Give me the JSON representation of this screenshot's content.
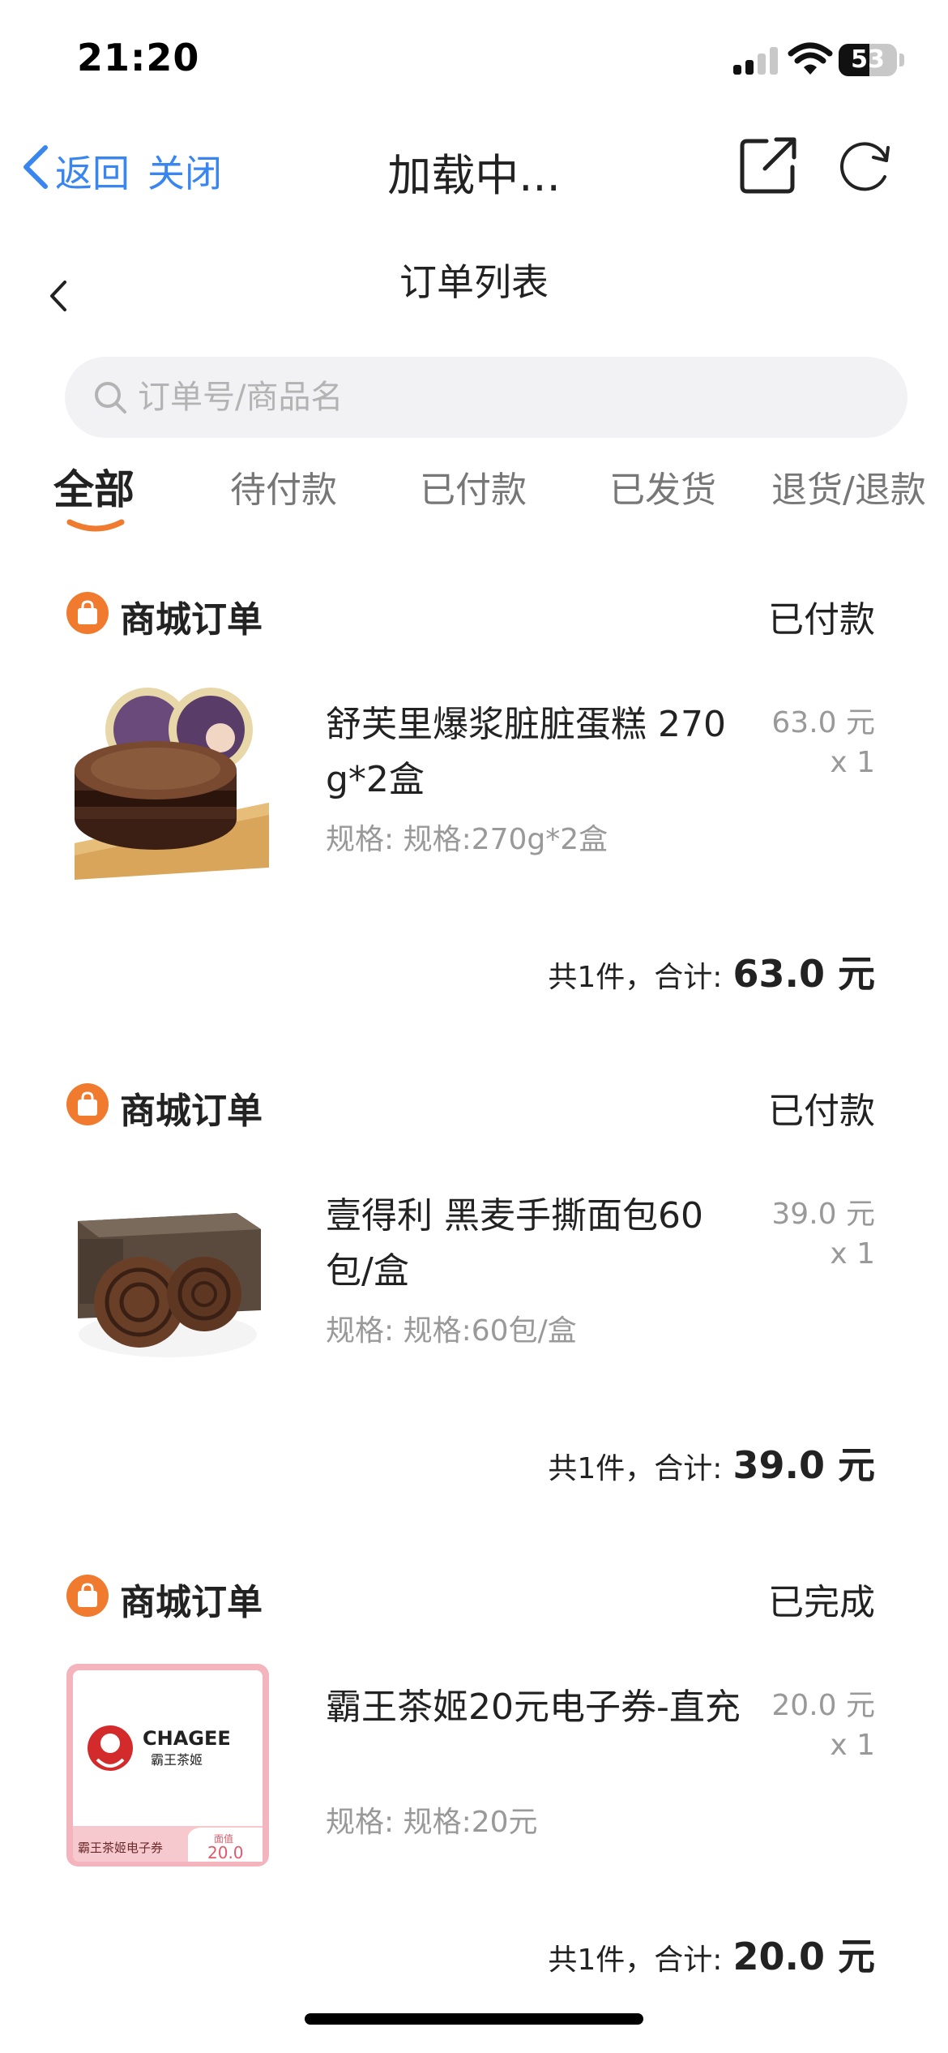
{
  "status_bar": {
    "time": "21:20",
    "battery": "53"
  },
  "nav": {
    "back_label": "返回",
    "close_label": "关闭",
    "title": "加载中..."
  },
  "page": {
    "title": "订单列表"
  },
  "search": {
    "placeholder": "订单号/商品名",
    "value": ""
  },
  "tabs": [
    {
      "label": "全部",
      "active": true
    },
    {
      "label": "待付款",
      "active": false
    },
    {
      "label": "已付款",
      "active": false
    },
    {
      "label": "已发货",
      "active": false
    },
    {
      "label": "退货/退款",
      "active": false
    }
  ],
  "orders": [
    {
      "type": "商城订单",
      "status": "已付款",
      "name": "舒芙里爆浆脏脏蛋糕 270g*2盒",
      "spec": "规格: 规格:270g*2盒",
      "price": "63.0 元",
      "qty": "x 1",
      "total_label": "共1件，合计:",
      "total_value": "63.0 元"
    },
    {
      "type": "商城订单",
      "status": "已付款",
      "name": "壹得利 黑麦手撕面包60包/盒",
      "spec": "规格: 规格:60包/盒",
      "price": "39.0 元",
      "qty": "x 1",
      "total_label": "共1件，合计:",
      "total_value": "39.0 元"
    },
    {
      "type": "商城订单",
      "status": "已完成",
      "name": "霸王茶姬20元电子券-直充",
      "spec": "规格: 规格:20元",
      "price": "20.0 元",
      "qty": "x 1",
      "total_label": "共1件，合计:",
      "total_value": "20.0 元",
      "voucher": {
        "brand": "CHAGEE",
        "brand_cn": "霸王茶姬",
        "caption": "霸王茶姬电子券",
        "tag": "面值",
        "amount": "20.0"
      }
    }
  ],
  "colors": {
    "link": "#3a86f0",
    "accent": "#f07a2e",
    "muted": "#999999"
  },
  "icons": [
    "signal-icon",
    "wifi-icon",
    "battery-icon",
    "back-chevron-icon",
    "share-icon",
    "refresh-icon",
    "search-icon",
    "shopping-bag-icon"
  ]
}
